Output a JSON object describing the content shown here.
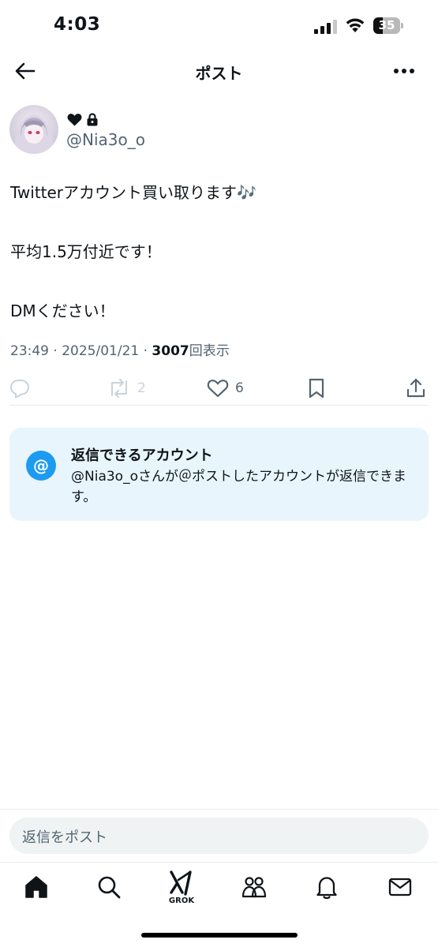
{
  "status_bar": {
    "time": "4:03",
    "battery_level": "35",
    "battery_fraction": 0.35
  },
  "nav": {
    "title": "ポスト",
    "back_icon": "arrow-left-icon",
    "more_icon": "more-horizontal-icon"
  },
  "post": {
    "author_handle": "@Nia3o_o",
    "badges": [
      "heart-icon",
      "lock-icon"
    ],
    "lines": [
      "Twitterアカウント買い取ります🎶",
      "平均1.5万付近です！",
      "DMください！"
    ],
    "time": "23:49",
    "separator": "·",
    "date": "2025/01/21",
    "views_count": "3007",
    "views_label": "回表示"
  },
  "actions": {
    "reply_icon": "reply-icon",
    "repost_icon": "repost-icon",
    "repost_count": "2",
    "like_icon": "heart-outline-icon",
    "like_count": "6",
    "bookmark_icon": "bookmark-icon",
    "share_icon": "share-icon"
  },
  "reply_restriction": {
    "icon_text": "@",
    "title": "返信できるアカウント",
    "description": "@Nia3o_oさんが＠ポストしたアカウントが返信できます。"
  },
  "compose": {
    "placeholder": "返信をポスト"
  },
  "tabbar": {
    "items": [
      {
        "name": "home",
        "icon": "home-icon"
      },
      {
        "name": "search",
        "icon": "search-icon"
      },
      {
        "name": "grok",
        "icon": "grok-icon",
        "label": "GROK"
      },
      {
        "name": "communities",
        "icon": "communities-icon"
      },
      {
        "name": "notifications",
        "icon": "bell-icon"
      },
      {
        "name": "messages",
        "icon": "mail-icon"
      }
    ]
  },
  "colors": {
    "accent": "#1d9bf0",
    "text_primary": "#0f1419",
    "text_secondary": "#536471",
    "card_bg": "#e8f5fd",
    "compose_bg": "#eff3f4"
  }
}
